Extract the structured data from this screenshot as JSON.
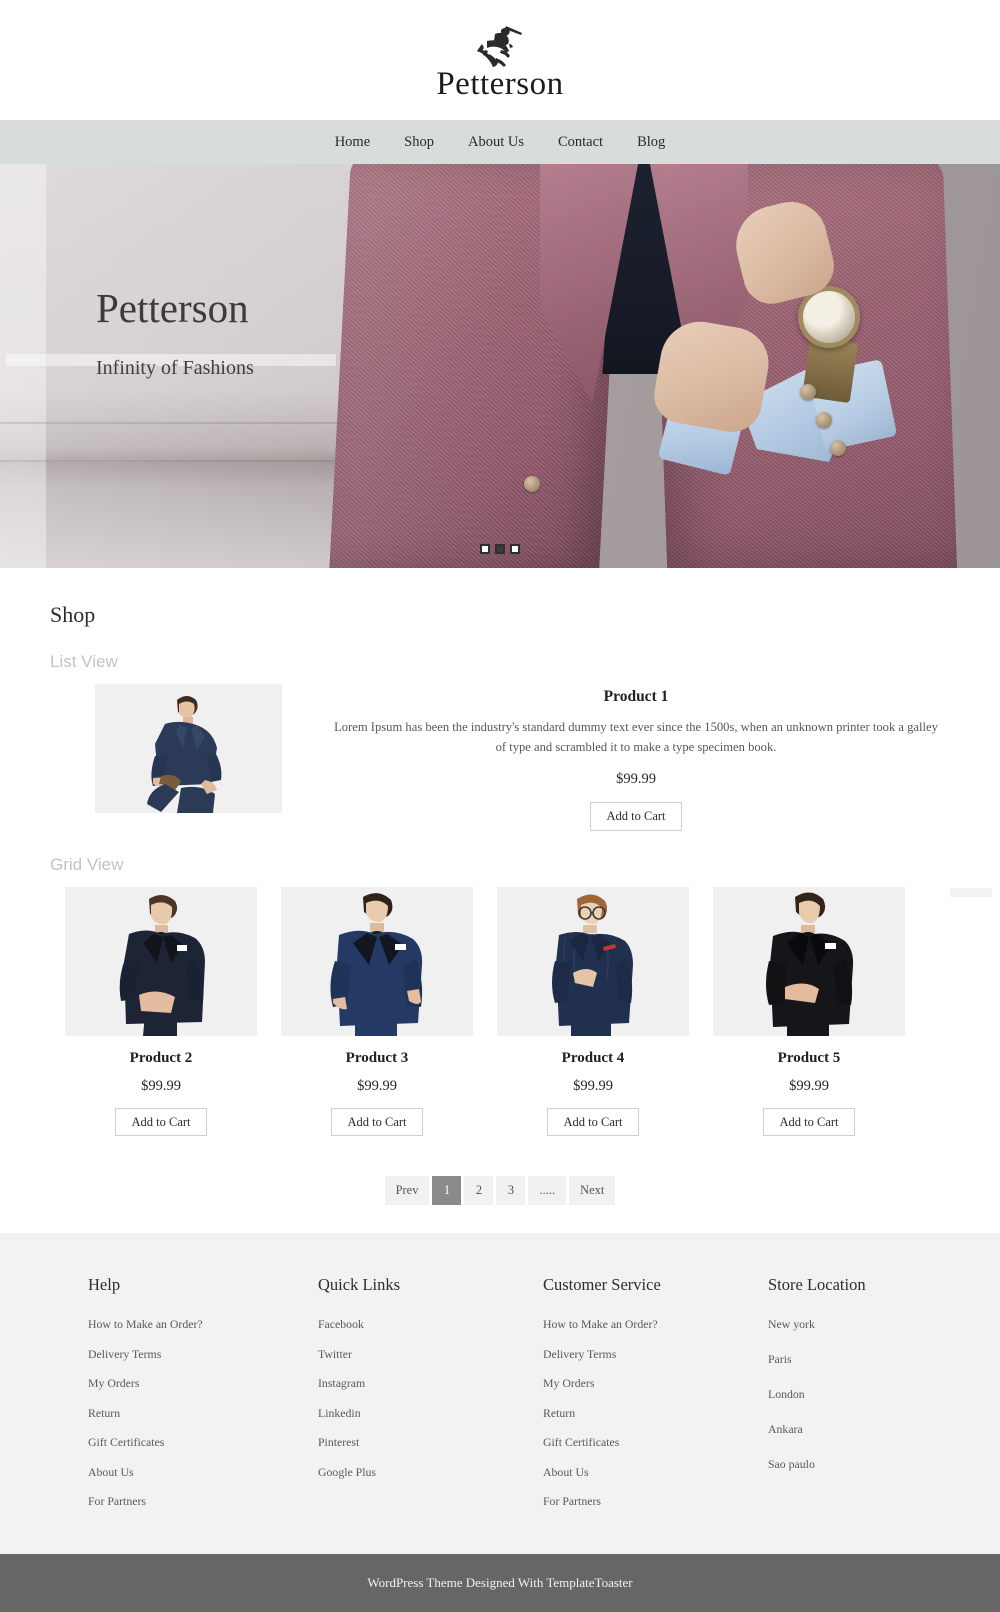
{
  "site": {
    "logo_text": "Petterson",
    "logo_mark": "knight-on-horseback-icon"
  },
  "nav": {
    "items": [
      {
        "label": "Home"
      },
      {
        "label": "Shop"
      },
      {
        "label": "About Us"
      },
      {
        "label": "Contact"
      },
      {
        "label": "Blog"
      }
    ]
  },
  "hero": {
    "title": "Petterson",
    "subtitle": "Infinity of Fashions",
    "slides_total": 3,
    "active_slide": 2
  },
  "shop": {
    "heading": "Shop",
    "list_view_label": "List View",
    "grid_view_label": "Grid View",
    "list_product": {
      "title": "Product 1",
      "description": "Lorem Ipsum has been the industry's standard dummy text ever since the 1500s, when an unknown printer took a galley of type and scrambled it to make a type specimen book.",
      "price": "$99.99",
      "cart_label": "Add to Cart",
      "image_alt": "man-in-navy-suit-seated"
    },
    "grid_products": [
      {
        "title": "Product 2",
        "price": "$99.99",
        "cart_label": "Add to Cart",
        "image_alt": "man-in-navy-tuxedo-hands-clasped"
      },
      {
        "title": "Product 3",
        "price": "$99.99",
        "cart_label": "Add to Cart",
        "image_alt": "man-in-blue-tuxedo-bowtie"
      },
      {
        "title": "Product 4",
        "price": "$99.99",
        "cart_label": "Add to Cart",
        "image_alt": "man-with-glasses-navy-suit-red-pocket-square"
      },
      {
        "title": "Product 5",
        "price": "$99.99",
        "cart_label": "Add to Cart",
        "image_alt": "man-in-black-tuxedo"
      }
    ],
    "pagination": {
      "prev": "Prev",
      "pages": [
        "1",
        "2",
        "3",
        "....."
      ],
      "next": "Next",
      "active_page": "1"
    }
  },
  "footer": {
    "columns": [
      {
        "title": "Help",
        "links": [
          "How to Make an Order?",
          "Delivery Terms",
          "My Orders",
          "Return",
          "Gift Certificates",
          "About Us",
          "For Partners"
        ]
      },
      {
        "title": "Quick Links",
        "links": [
          "Facebook",
          "Twitter",
          "Instagram",
          "Linkedin",
          "Pinterest",
          "Google Plus"
        ]
      },
      {
        "title": "Customer Service",
        "links": [
          "How to Make an Order?",
          "Delivery Terms",
          "My Orders",
          "Return",
          "Gift Certificates",
          "About Us",
          "For Partners"
        ]
      },
      {
        "title": "Store Location",
        "links": [
          "New york",
          "Paris",
          "London",
          "Ankara",
          "Sao paulo"
        ]
      }
    ],
    "bottom_text": "WordPress Theme Designed With TemplateToaster"
  },
  "colors": {
    "navbar_bg": "#d8dcdd",
    "footer_bg": "#f2f2f2",
    "footer_bottom_bg": "#666666",
    "pagination_active_bg": "#8a8a8a",
    "thumb_bg": "#f0f0f0",
    "muted_label": "#c3c3c3"
  }
}
